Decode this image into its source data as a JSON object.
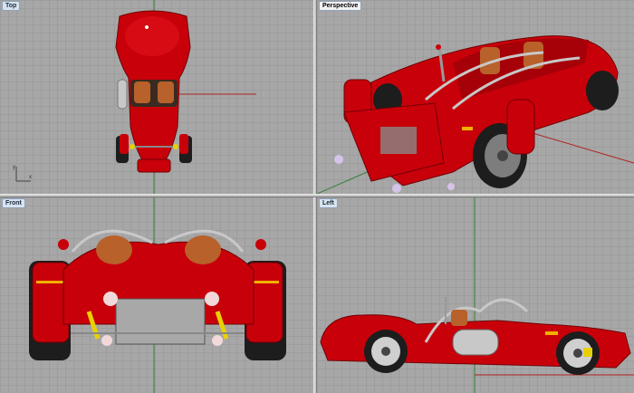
{
  "viewports": {
    "top": {
      "label": "Top"
    },
    "perspective": {
      "label": "Perspective"
    },
    "front": {
      "label": "Front"
    },
    "left": {
      "label": "Left"
    }
  },
  "axes": {
    "x": "x",
    "y": "y"
  },
  "colors": {
    "body_red": "#c8000a",
    "body_dark": "#6e0005",
    "axis_red": "#b22020",
    "axis_green": "#2f7f2f",
    "chrome": "#c8c8c8",
    "seat": "#b8612b",
    "tire": "#1d1d1d"
  }
}
